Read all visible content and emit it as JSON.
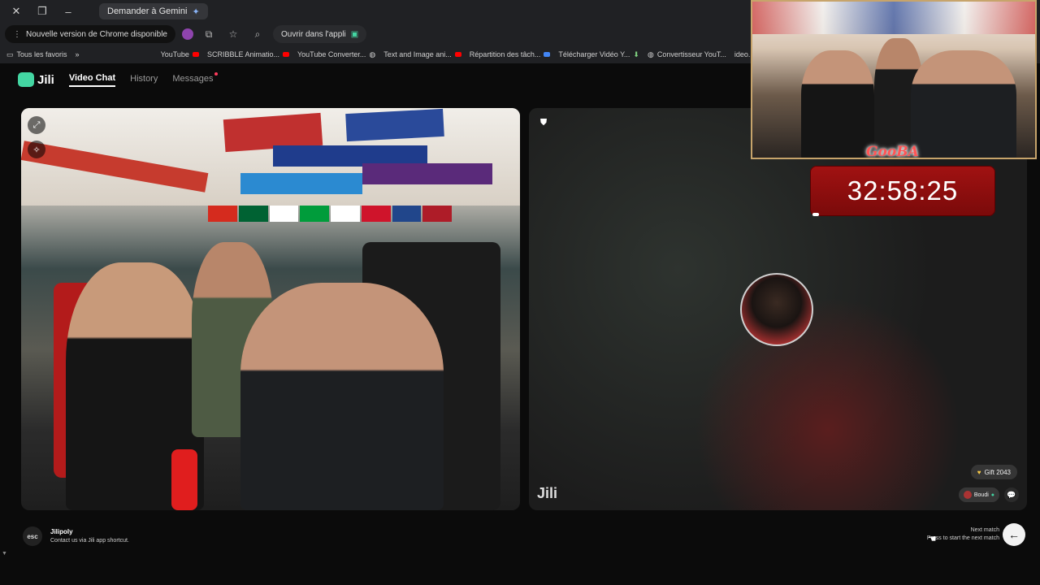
{
  "browser": {
    "tab_title": "Demander à Gemini",
    "notice": "Nouvelle version de Chrome disponible",
    "address": "Ouvrir dans l'appli",
    "bookmarks": [
      "Tous les favoris",
      "YouTube",
      "SCRIBBLE Animatio...",
      "YouTube Converter...",
      "Text and Image ani...",
      "Répartition des tâch...",
      "Télécharger Vidéo Y...",
      "Convertisseur YouT...",
      "ideo..."
    ]
  },
  "app": {
    "logo_text": "Jili",
    "nav": [
      "Video Chat",
      "History",
      "Messages"
    ]
  },
  "stream_overlay": {
    "streamer_name": "GooBA",
    "timer": "32:58:25"
  },
  "right_panel": {
    "watermark": "Jili",
    "gift_badge": "Gift 2043",
    "user_chip": "Boudi"
  },
  "footer": {
    "esc_label": "esc",
    "left_title": "Jilipoly",
    "left_sub": "Contact us via Jili app shortcut.",
    "right_title": "Next match",
    "right_sub": "Press to start the next match"
  },
  "colors": {
    "accent": "#43d6a2",
    "timer_bg": "#a11212",
    "badge_red": "#ff3b5c"
  }
}
